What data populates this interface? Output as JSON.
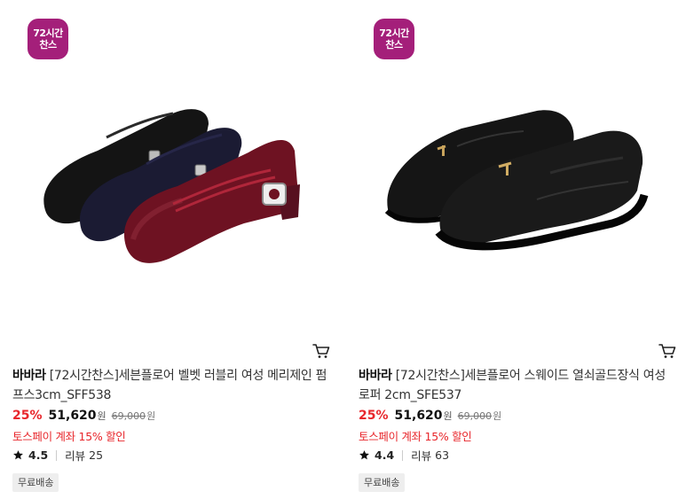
{
  "products": [
    {
      "badge_line1": "72시간",
      "badge_line2": "찬스",
      "brand": "바바라",
      "name": "[72시간찬스]세븐플로어 벨벳 러블리 여성 메리제인 펌프스3cm_SFF538",
      "discount": "25%",
      "price": "51,620",
      "price_unit": "원",
      "original_price": "69,000",
      "original_unit": "원",
      "promo": "토스페이 계좌 15% 할인",
      "rating": "4.5",
      "review_label": "리뷰",
      "review_count": "25",
      "shipping": "무료배송",
      "image_icon": "velvet-mary-jane-shoes-image",
      "cart_icon": "cart-icon"
    },
    {
      "badge_line1": "72시간",
      "badge_line2": "찬스",
      "brand": "바바라",
      "name": "[72시간찬스]세븐플로어 스웨이드 열쇠골드장식 여성로퍼 2cm_SFE537",
      "discount": "25%",
      "price": "51,620",
      "price_unit": "원",
      "original_price": "69,000",
      "original_unit": "원",
      "promo": "토스페이 계좌 15% 할인",
      "rating": "4.4",
      "review_label": "리뷰",
      "review_count": "63",
      "shipping": "무료배송",
      "image_icon": "black-suede-loafers-image",
      "cart_icon": "cart-icon"
    }
  ],
  "colors": {
    "badge": "#a41f7a",
    "discount": "#e8262b",
    "promo": "#e8262b"
  }
}
